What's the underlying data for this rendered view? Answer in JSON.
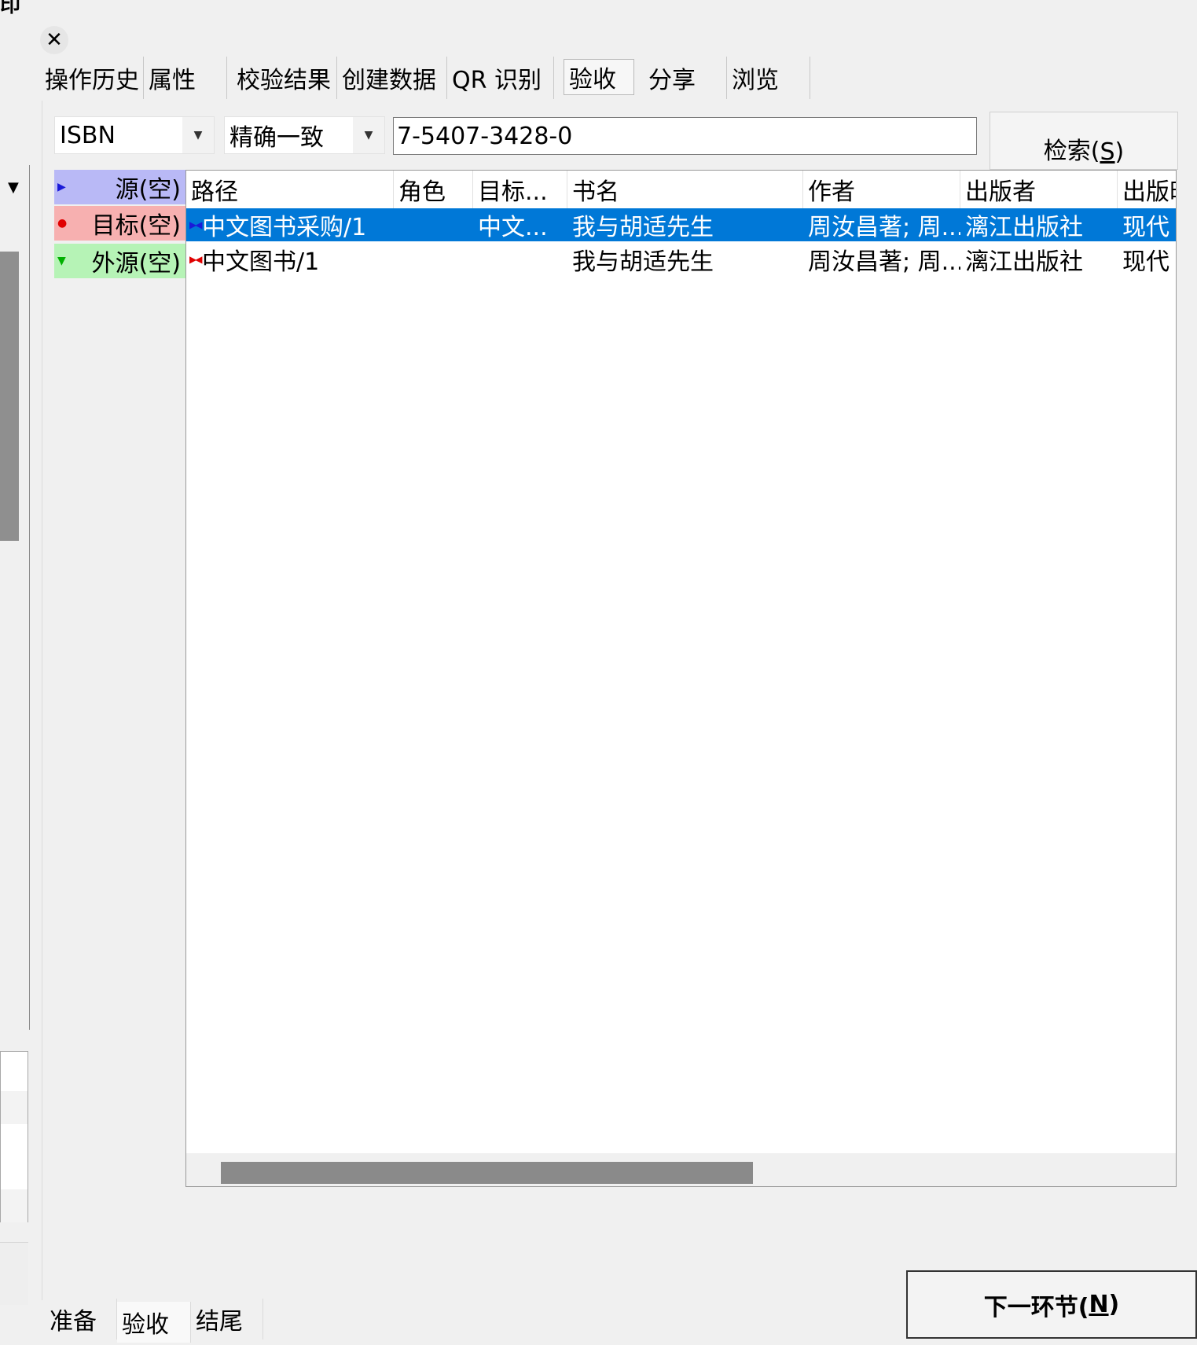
{
  "window": {
    "title_fragment": "印",
    "close_glyph": "✕"
  },
  "tabs": [
    {
      "label": "操作历史"
    },
    {
      "label": "属性"
    },
    {
      "label": "校验结果"
    },
    {
      "label": "创建数据"
    },
    {
      "label": "QR 识别"
    },
    {
      "label": "验收",
      "active": true
    },
    {
      "label": "分享"
    },
    {
      "label": "浏览"
    }
  ],
  "search": {
    "field_select": "ISBN",
    "match_select": "精确一致",
    "query": "7-5407-3428-0",
    "button_label": "检索(",
    "button_accel": "S",
    "button_tail": ")"
  },
  "legend": {
    "source": "源(空)",
    "target": "目标(空)",
    "external": "外源(空)",
    "colors": {
      "source": "#b9b9f6",
      "target": "#f7b0b0",
      "external": "#b6f3b6"
    }
  },
  "grid": {
    "columns": [
      "路径",
      "角色",
      "目标...",
      "书名",
      "作者",
      "出版者",
      "出版时"
    ],
    "rows": [
      {
        "path": "中文图书采购/1",
        "role": "",
        "target": "中文...",
        "title": "我与胡适先生",
        "author": "周汝昌著; 周...",
        "publisher": "漓江出版社",
        "pubdate": "现代",
        "selected": true
      },
      {
        "path": "中文图书/1",
        "role": "",
        "target": "",
        "title": "我与胡适先生",
        "author": "周汝昌著; 周...",
        "publisher": "漓江出版社",
        "pubdate": "现代",
        "selected": false
      }
    ],
    "selected_color": "#0078d7"
  },
  "bottom_tabs": [
    {
      "label": "准备"
    },
    {
      "label": "验收",
      "active": true
    },
    {
      "label": "结尾"
    }
  ],
  "next_button": {
    "label": "下一环节(",
    "accel": "N",
    "tail": ")"
  }
}
